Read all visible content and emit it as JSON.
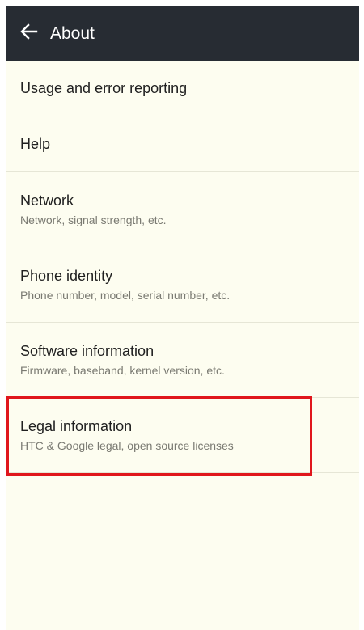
{
  "appbar": {
    "title": "About",
    "back_icon": "arrow-left-icon"
  },
  "items": [
    {
      "title": "Usage and error reporting",
      "subtitle": ""
    },
    {
      "title": "Help",
      "subtitle": ""
    },
    {
      "title": "Network",
      "subtitle": "Network, signal strength, etc."
    },
    {
      "title": "Phone identity",
      "subtitle": "Phone number, model, serial number, etc."
    },
    {
      "title": "Software information",
      "subtitle": "Firmware, baseband, kernel version, etc."
    },
    {
      "title": "Legal information",
      "subtitle": "HTC & Google legal, open source licenses"
    }
  ],
  "colors": {
    "appbar_bg": "#272c33",
    "list_bg": "#fdfdf0",
    "highlight": "#e0161c"
  }
}
